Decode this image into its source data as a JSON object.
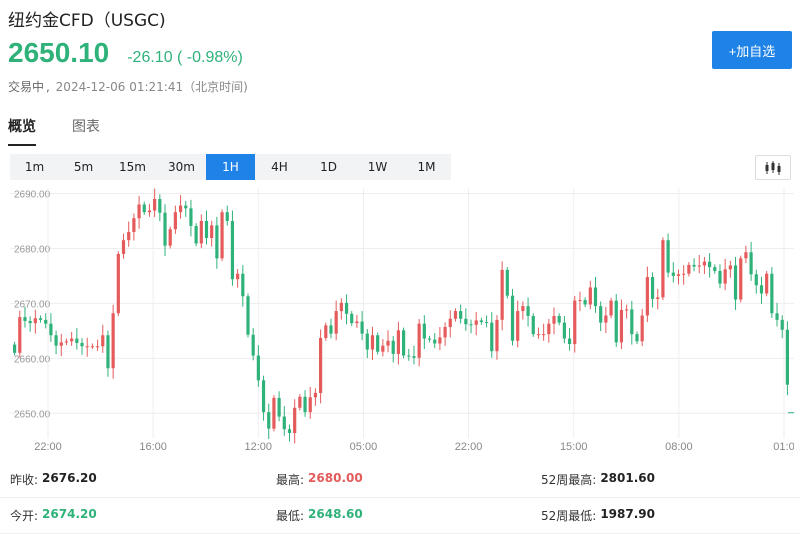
{
  "header": {
    "title": "纽约金CFD（USGC)",
    "price": "2650.10",
    "change": "-26.10 ( -0.98%)",
    "status": "交易中",
    "status_sep": ",",
    "timestamp": "2024-12-06 01:21:41（北京时间)",
    "add_button": "+加自选"
  },
  "tabs": [
    {
      "label": "概览",
      "active": true
    },
    {
      "label": "图表",
      "active": false
    }
  ],
  "periods": [
    {
      "label": "1m"
    },
    {
      "label": "5m"
    },
    {
      "label": "15m"
    },
    {
      "label": "30m"
    },
    {
      "label": "1H",
      "active": true
    },
    {
      "label": "4H"
    },
    {
      "label": "1D"
    },
    {
      "label": "1W"
    },
    {
      "label": "1M"
    }
  ],
  "colors": {
    "up": "#e55b5b",
    "down": "#2fb27a",
    "accent": "#1e82e6",
    "grid": "#eeeeee"
  },
  "chart_data": {
    "type": "candlestick",
    "y_ticks": [
      "2690.00",
      "2680.00",
      "2670.00",
      "2660.00",
      "2650.00"
    ],
    "ylim": [
      2645.5,
      2691
    ],
    "x_ticks": [
      "22:00",
      "16:00",
      "12:00",
      "05:00",
      "22:00",
      "15:00",
      "08:00",
      "01:0"
    ],
    "grid": true,
    "closes": [
      2661,
      2667.5,
      2666.8,
      2666.4,
      2667.3,
      2667,
      2666.3,
      2664.2,
      2662.3,
      2662.9,
      2663.1,
      2663.6,
      2662.8,
      2662.2,
      2662.2,
      2662.2,
      2662.2,
      2664.2,
      2658.2,
      2668.2,
      2679,
      2681.5,
      2683,
      2685.5,
      2688,
      2686.6,
      2686.9,
      2689,
      2686.5,
      2680.5,
      2683.5,
      2686.6,
      2687.8,
      2687.3,
      2684.1,
      2680.9,
      2685,
      2681.9,
      2684.2,
      2678.2,
      2686.6,
      2685,
      2674.4,
      2675.4,
      2671.3,
      2664.3,
      2660.5,
      2656,
      2650.2,
      2647.2,
      2652.8,
      2649.4,
      2647.1,
      2646.4,
      2651,
      2653,
      2650.2,
      2652.9,
      2653.7,
      2663.7,
      2666,
      2664.5,
      2668.6,
      2670.1,
      2668.1,
      2666.4,
      2666.7,
      2664.5,
      2661.6,
      2664.2,
      2661.2,
      2662.3,
      2663.2,
      2660.8,
      2665.1,
      2660.5,
      2660.4,
      2660.1,
      2666.3,
      2663.6,
      2663.4,
      2662.7,
      2663.8,
      2665.7,
      2667.2,
      2668.6,
      2667.2,
      2666.2,
      2666.1,
      2666.9,
      2666.6,
      2666.5,
      2661.3,
      2667,
      2676.1,
      2671.4,
      2663.2,
      2668.6,
      2669.5,
      2667.7,
      2664.4,
      2664.4,
      2664.4,
      2666.3,
      2667.7,
      2666.5,
      2663.6,
      2662.6,
      2670.5,
      2670.6,
      2669.8,
      2672.9,
      2669.5,
      2666.5,
      2667.8,
      2670.5,
      2662.9,
      2668.8,
      2668.9,
      2664.4,
      2663.1,
      2667.8,
      2674.8,
      2670.8,
      2671.1,
      2681.5,
      2675.6,
      2675,
      2675.3,
      2675.4,
      2677,
      2676.7,
      2676.9,
      2677.6,
      2676.6,
      2675.9,
      2673.6,
      2676.2,
      2676.9,
      2670.7,
      2678.2,
      2679.3,
      2675.3,
      2673.3,
      2671.8,
      2675.4,
      2668.2,
      2667,
      2665.2,
      2655.2
    ],
    "last": "2650.10"
  },
  "stats": [
    [
      {
        "label": "昨收:",
        "value": "2676.20",
        "tone": ""
      },
      {
        "label": "最高:",
        "value": "2680.00",
        "tone": "up"
      },
      {
        "label": "52周最高:",
        "value": "2801.60",
        "tone": ""
      }
    ],
    [
      {
        "label": "今开:",
        "value": "2674.20",
        "tone": "down"
      },
      {
        "label": "最低:",
        "value": "2648.60",
        "tone": "down"
      },
      {
        "label": "52周最低:",
        "value": "1987.90",
        "tone": ""
      }
    ]
  ]
}
